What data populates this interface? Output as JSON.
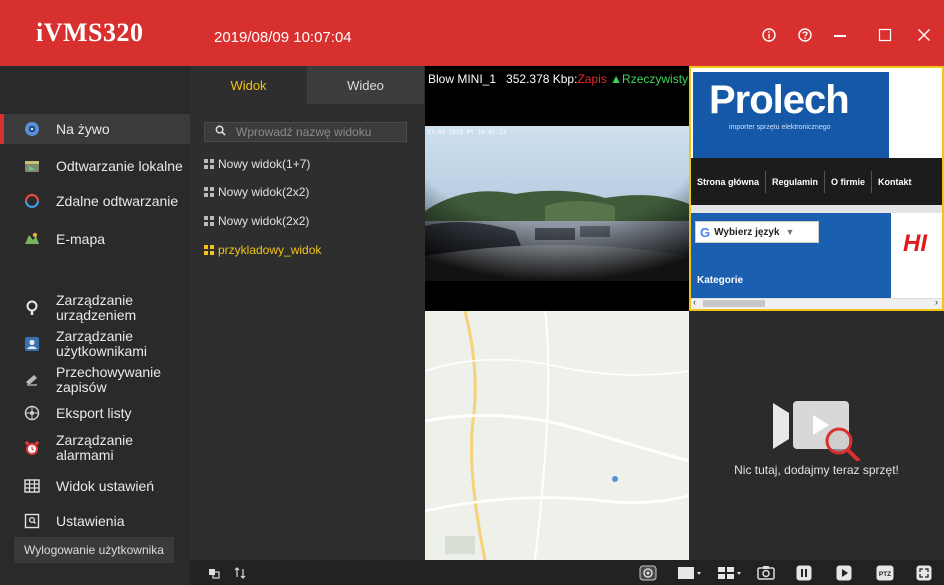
{
  "app": {
    "title": "iVMS320",
    "datetime": "2019/08/09 10:07:04"
  },
  "window_controls": [
    "info-icon",
    "help-icon",
    "minimize-icon",
    "maximize-icon",
    "close-icon"
  ],
  "sidebar": {
    "items": [
      {
        "label": "Na żywo",
        "icon": "live-view-icon",
        "active": true
      },
      {
        "label": "Odtwarzanie lokalne",
        "icon": "local-playback-icon"
      },
      {
        "label": "Zdalne odtwarzanie",
        "icon": "remote-playback-icon"
      },
      {
        "label": "E-mapa",
        "icon": "emap-icon"
      },
      {
        "label": "Zarządzanie urządzeniem",
        "icon": "device-management-icon"
      },
      {
        "label": "Zarządzanie użytkownikami",
        "icon": "user-management-icon"
      },
      {
        "label": "Przechowywanie zapisów",
        "icon": "storage-icon"
      },
      {
        "label": "Eksport listy",
        "icon": "export-list-icon"
      },
      {
        "label": "Zarządzanie alarmami",
        "icon": "alarm-icon"
      },
      {
        "label": "Widok ustawień",
        "icon": "settings-view-icon"
      },
      {
        "label": "Ustawienia",
        "icon": "settings-icon"
      }
    ],
    "logout_label": "Wylogowanie użytkownika"
  },
  "panel": {
    "tabs": [
      "Widok",
      "Wideo"
    ],
    "search_placeholder": "Wprowadź nazwę widoku",
    "views": [
      {
        "label": "Nowy widok(1+7)"
      },
      {
        "label": "Nowy widok(2x2)"
      },
      {
        "label": "Nowy widok(2x2)"
      },
      {
        "label": "przykladowy_widok",
        "selected": true
      }
    ]
  },
  "video": {
    "camera_name": "Blow MINI_1",
    "bitrate": "352.378 Kbp:",
    "rec_label": "Zapis",
    "live_label": "Rzeczywisty",
    "osd_timestamp": "27-08-2019 Pt 10:07:23",
    "empty_message": "Nic tutaj, dodajmy teraz sprzęt!"
  },
  "webpage": {
    "logo": "Prolech",
    "logo_sub": "importer sprzętu elektronicznego",
    "menu": [
      "Strona główna",
      "Regulamin",
      "O firmie",
      "Kontakt"
    ],
    "translate_label": "Wybierz język",
    "category_label": "Kategorie",
    "side_logo": "HI"
  },
  "toolbar": [
    "snapshot-window-icon",
    "swap-icon",
    "fisheye-icon",
    "layout-single-icon",
    "layout-grid-icon",
    "capture-icon",
    "pause-icon",
    "play-icon",
    "ptz-icon",
    "fullscreen-icon"
  ],
  "toolbar_ptz_label": "PTZ",
  "colors": {
    "title_bar": "#d8302f",
    "accent_yellow": "#f0c419",
    "rec_red": "#e52b2b",
    "live_green": "#3cd55a"
  }
}
